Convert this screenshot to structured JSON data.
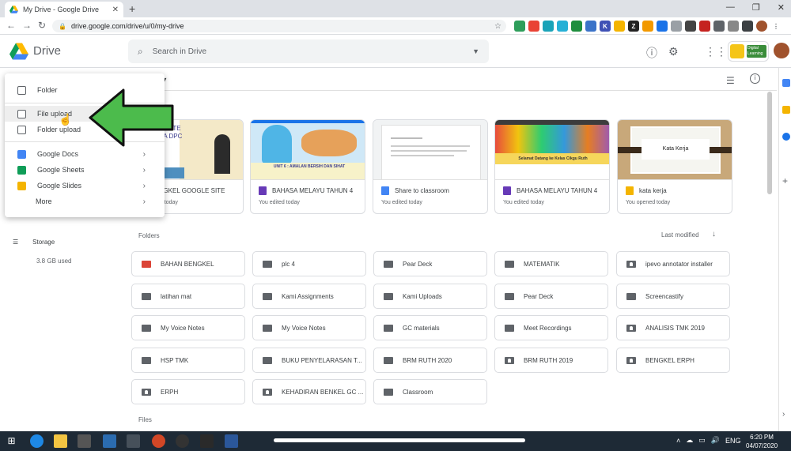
{
  "browser": {
    "tab_title": "My Drive - Google Drive",
    "url": "drive.google.com/drive/u/0/my-drive",
    "back_icon": "arrow-left-icon",
    "forward_icon": "arrow-right-icon",
    "reload_icon": "reload-icon"
  },
  "header": {
    "brand": "Drive",
    "search_placeholder": "Search in Drive",
    "help_icon": "help-icon",
    "settings_icon": "gear-icon",
    "apps_icon": "apps-grid-icon",
    "badge_text": "Digital Learning"
  },
  "toolbar": {
    "breadcrumb": "e",
    "view_icon": "list-view-icon",
    "info_icon": "info-icon"
  },
  "new_menu": {
    "items": [
      {
        "label": "Folder",
        "icon": "new-folder-icon"
      },
      {
        "label": "File upload",
        "icon": "file-upload-icon"
      },
      {
        "label": "Folder upload",
        "icon": "folder-upload-icon"
      },
      {
        "label": "Google Docs",
        "icon": "docs-icon"
      },
      {
        "label": "Google Sheets",
        "icon": "sheets-icon"
      },
      {
        "label": "Google Slides",
        "icon": "slides-icon"
      },
      {
        "label": "More",
        "icon": "more-icon"
      }
    ]
  },
  "sidebar": {
    "storage_label": "Storage",
    "storage_used": "3.8 GB used"
  },
  "quick_access": [
    {
      "name": "BENGKEL GOOGLE SITE",
      "sub": "You edited today",
      "type": "sites",
      "thumb_text": "NAKAN SITE EMBINA DPC"
    },
    {
      "name": "BAHASA MELAYU TAHUN 4",
      "sub": "You edited today",
      "type": "forms",
      "thumb_text": "UNIT 6 : AMALAN BERSIH DAN SIHAT"
    },
    {
      "name": "Share to classroom",
      "sub": "You edited today",
      "type": "docs",
      "thumb_text": ""
    },
    {
      "name": "BAHASA MELAYU TAHUN 4",
      "sub": "You edited today",
      "type": "forms",
      "thumb_text": "Selamat Datang ke Kelas Cikgu Ruth"
    },
    {
      "name": "kata kerja",
      "sub": "You opened today",
      "type": "slides",
      "thumb_text": "Kata Kerja"
    }
  ],
  "sections": {
    "folders": "Folders",
    "files": "Files",
    "sort_label": "Last modified",
    "sort_icon": "arrow-down-icon"
  },
  "folders": [
    {
      "name": "BAHAN BENGKEL",
      "icon": "folder-red-icon"
    },
    {
      "name": "plc 4",
      "icon": "folder-icon"
    },
    {
      "name": "Pear Deck",
      "icon": "folder-icon"
    },
    {
      "name": "MATEMATIK",
      "icon": "folder-icon"
    },
    {
      "name": "ipevo annotator installer",
      "icon": "shared-folder-icon"
    },
    {
      "name": "latihan mat",
      "icon": "folder-icon"
    },
    {
      "name": "Kami Assignments",
      "icon": "folder-icon"
    },
    {
      "name": "Kami Uploads",
      "icon": "folder-icon"
    },
    {
      "name": "Pear Deck",
      "icon": "folder-icon"
    },
    {
      "name": "Screencastify",
      "icon": "folder-icon"
    },
    {
      "name": "My Voice Notes",
      "icon": "folder-icon"
    },
    {
      "name": "My Voice Notes",
      "icon": "folder-icon"
    },
    {
      "name": "GC materials",
      "icon": "folder-icon"
    },
    {
      "name": "Meet Recordings",
      "icon": "folder-icon"
    },
    {
      "name": "ANALISIS TMK 2019",
      "icon": "shared-folder-icon"
    },
    {
      "name": "HSP TMK",
      "icon": "folder-icon"
    },
    {
      "name": "BUKU PENYELARASAN T...",
      "icon": "folder-icon"
    },
    {
      "name": "BRM RUTH 2020",
      "icon": "folder-icon"
    },
    {
      "name": "BRM RUTH 2019",
      "icon": "shared-folder-icon"
    },
    {
      "name": "BENGKEL ERPH",
      "icon": "shared-folder-icon"
    },
    {
      "name": "ERPH",
      "icon": "shared-folder-icon"
    },
    {
      "name": "KEHADIRAN BENKEL GC ...",
      "icon": "shared-folder-icon"
    },
    {
      "name": "Classroom",
      "icon": "folder-icon"
    }
  ],
  "taskbar": {
    "lang": "ENG",
    "time": "6:20 PM",
    "date": "04/07/2020"
  },
  "colors": {
    "accent_blue": "#4285f4",
    "arrow_green": "#4cbb4c"
  }
}
